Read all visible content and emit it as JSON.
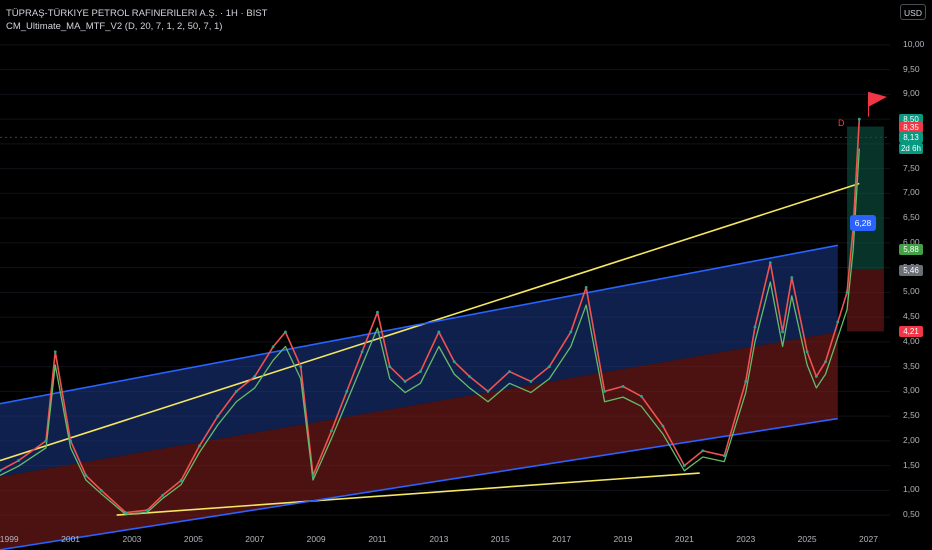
{
  "header": {
    "title": "TÜPRAŞ-TÜRKIYE PETROL RAFINERILERI A.Ş. · 1H · BIST",
    "indicator": "CM_Ultimate_MA_MTF_V2 (D, 20, 7, 1, 2, 50, 7, 1)",
    "currency_button": "USD"
  },
  "price_tags": {
    "high": "8,50",
    "stop": "8,35",
    "last_price": "8,13",
    "countdown": "2d 6h",
    "ma": "5,88",
    "entry": "5,46",
    "low": "4,21",
    "bubble": "6,28"
  },
  "markers": {
    "d_label": "D"
  },
  "colors": {
    "background": "#000000",
    "channel_blue": "#2962ff",
    "trend_yellow": "#f5e663",
    "up_candle": "#26a69a",
    "down_candle": "#ef5350",
    "ma_green": "#66bb6a",
    "tag_green": "#089981",
    "tag_red": "#f23645"
  },
  "chart_data": {
    "type": "line",
    "y_axis": {
      "ticks": [
        "10,00",
        "9,50",
        "9,00",
        "8,50",
        "8,00",
        "7,50",
        "7,00",
        "6,50",
        "6,00",
        "5,50",
        "5,00",
        "4,50",
        "4,00",
        "3,50",
        "3,00",
        "2,50",
        "2,00",
        "1,50",
        "1,00",
        "0,50"
      ],
      "ylim": [
        0.3,
        10.3
      ]
    },
    "x_axis": {
      "ticks": [
        "1999",
        "2001",
        "2003",
        "2005",
        "2007",
        "2009",
        "2011",
        "2013",
        "2015",
        "2017",
        "2019",
        "2021",
        "2023",
        "2025",
        "2027"
      ],
      "xlim": [
        1998.7,
        2027.7
      ]
    },
    "price": {
      "x": [
        1998.7,
        1999.3,
        2000.2,
        2000.5,
        2001.0,
        2001.5,
        2002.0,
        2002.8,
        2003.5,
        2004.0,
        2004.6,
        2005.2,
        2005.8,
        2006.4,
        2007.0,
        2007.6,
        2008.0,
        2008.5,
        2008.9,
        2009.5,
        2010.0,
        2010.5,
        2011.0,
        2011.4,
        2011.9,
        2012.4,
        2013.0,
        2013.5,
        2014.0,
        2014.6,
        2015.3,
        2016.0,
        2016.6,
        2017.3,
        2017.8,
        2018.4,
        2019.0,
        2019.6,
        2020.3,
        2021.0,
        2021.6,
        2022.3,
        2023.0,
        2023.3,
        2023.8,
        2024.2,
        2024.5,
        2025.0,
        2025.3,
        2025.6,
        2026.0,
        2026.3,
        2026.5,
        2026.7
      ],
      "y": [
        1.4,
        1.6,
        2.0,
        3.8,
        2.0,
        1.3,
        1.0,
        0.55,
        0.6,
        0.9,
        1.2,
        1.9,
        2.5,
        3.0,
        3.3,
        3.9,
        4.2,
        3.5,
        1.3,
        2.2,
        3.0,
        3.8,
        4.6,
        3.5,
        3.2,
        3.4,
        4.2,
        3.6,
        3.3,
        3.0,
        3.4,
        3.2,
        3.5,
        4.2,
        5.1,
        3.0,
        3.1,
        2.9,
        2.3,
        1.5,
        1.8,
        1.7,
        3.2,
        4.3,
        5.6,
        4.2,
        5.3,
        3.8,
        3.3,
        3.6,
        4.4,
        5.0,
        6.3,
        8.5
      ]
    },
    "levels": {
      "high": 8.5,
      "stop": 8.35,
      "last": 8.13,
      "ma": 5.88,
      "entry": 5.46,
      "low": 4.21,
      "bubble": 6.28
    },
    "trendlines": [
      {
        "color": "yellow",
        "x": [
          1998.7,
          2026.7
        ],
        "y": [
          1.6,
          7.2
        ]
      },
      {
        "color": "yellow",
        "x": [
          2002.5,
          2021.5
        ],
        "y": [
          0.5,
          1.35
        ]
      },
      {
        "color": "blue",
        "x": [
          1998.7,
          2026.0
        ],
        "y": [
          2.75,
          5.95
        ]
      },
      {
        "color": "blue",
        "x": [
          1998.7,
          2026.0
        ],
        "y": [
          -0.2,
          2.45
        ]
      }
    ]
  }
}
